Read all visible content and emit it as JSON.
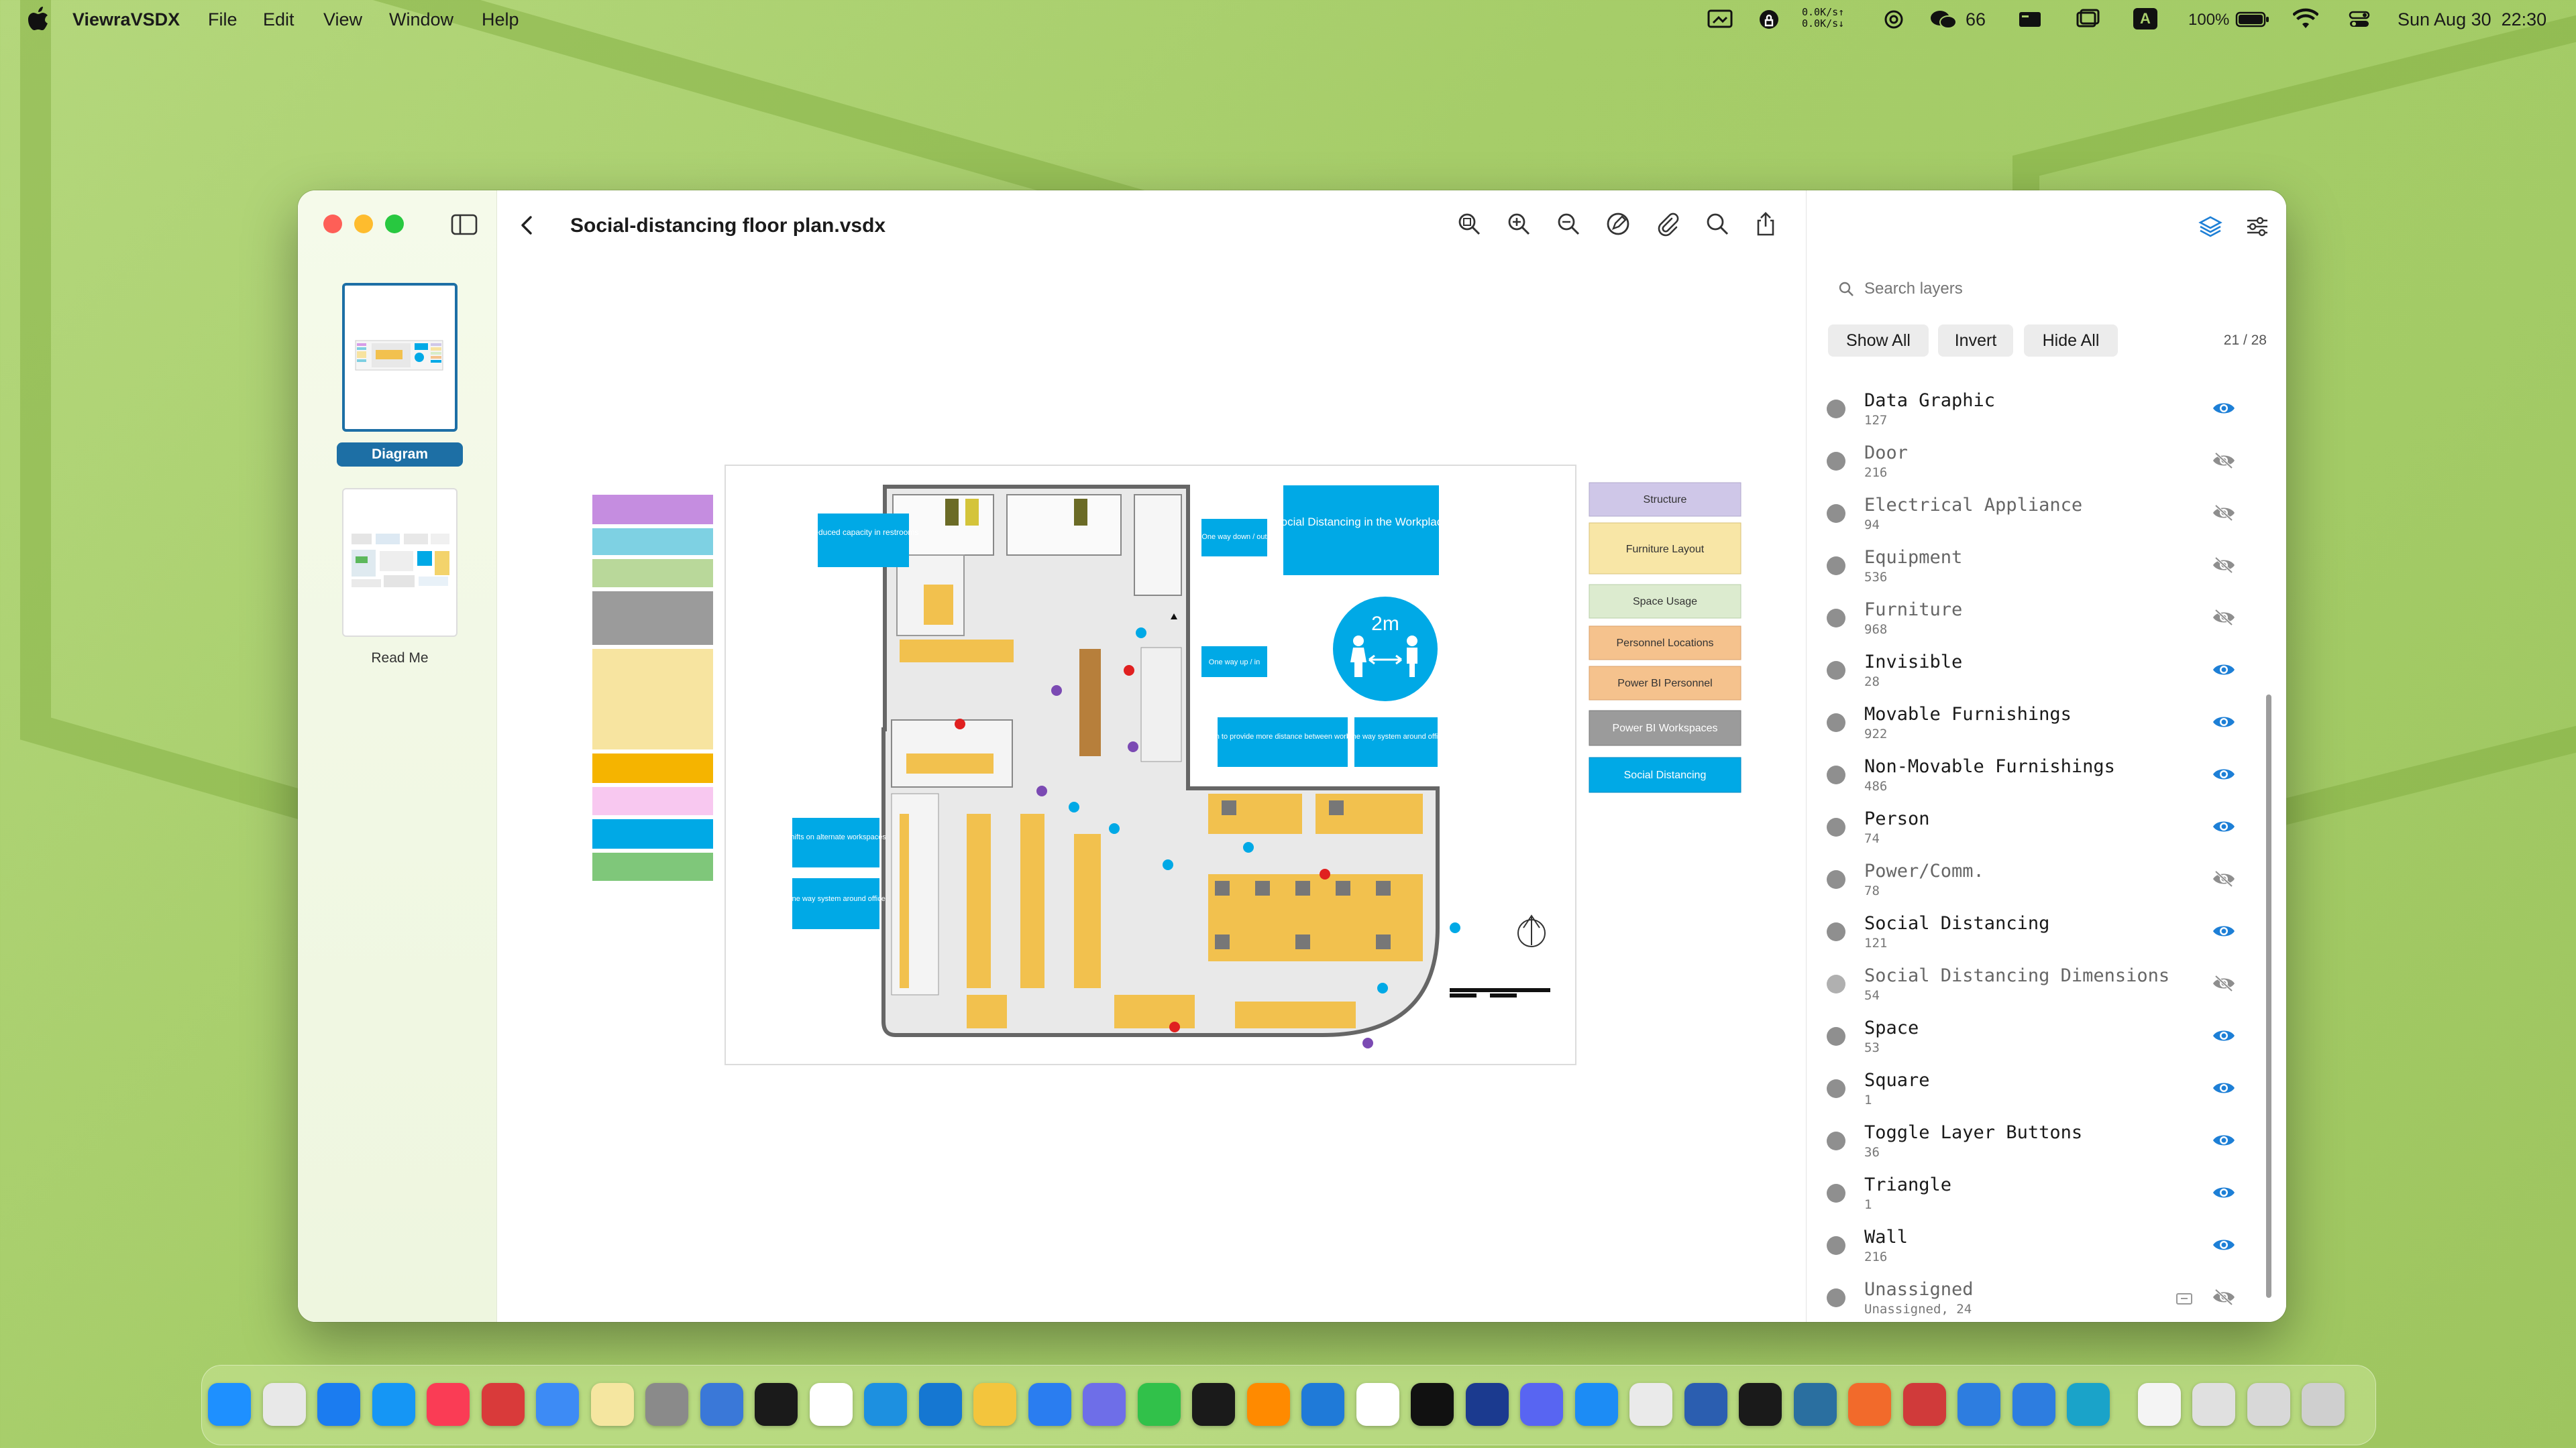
{
  "menubar": {
    "app_name": "ViewraVSDX",
    "menus": [
      "File",
      "Edit",
      "View",
      "Window",
      "Help"
    ],
    "net_up": "0.0K/s↑",
    "net_down": "0.0K/s↓",
    "wechat_count": "66",
    "input_method": "A",
    "battery": "100%",
    "datetime": "Sun Aug 30  22:30"
  },
  "window": {
    "title": "Social-distancing floor plan.vsdx",
    "pages": [
      {
        "label": "Diagram",
        "selected": true
      },
      {
        "label": "Read Me",
        "selected": false
      }
    ]
  },
  "diagram": {
    "legend_right": [
      "Structure",
      "Furniture Layout",
      "Space Usage",
      "Personnel Locations",
      "Power BI Personnel",
      "Power BI Workspaces",
      "Social Distancing"
    ],
    "signs": {
      "restroom": "Reduced capacity in restrooms",
      "one_way_down": "One way down / out",
      "one_way_up": "One way up / in",
      "workplace": "Social Distancing in the Workplace",
      "distance": "2m",
      "replan": "Re-plan to provide more distance between workstation",
      "one_way_system_mid": "One way system around office",
      "shifts": "Shifts on alternate workspaces",
      "one_way_system_left": "One way system around office"
    }
  },
  "layers_panel": {
    "search_placeholder": "Search layers",
    "show_all": "Show All",
    "invert": "Invert",
    "hide_all": "Hide All",
    "count": "21 / 28",
    "layers": [
      {
        "name": "Data Graphic",
        "count": "127",
        "visible": true
      },
      {
        "name": "Door",
        "count": "216",
        "visible": false
      },
      {
        "name": "Electrical Appliance",
        "count": "94",
        "visible": false
      },
      {
        "name": "Equipment",
        "count": "536",
        "visible": false
      },
      {
        "name": "Furniture",
        "count": "968",
        "visible": false
      },
      {
        "name": "Invisible",
        "count": "28",
        "visible": true
      },
      {
        "name": "Movable Furnishings",
        "count": "922",
        "visible": true
      },
      {
        "name": "Non-Movable Furnishings",
        "count": "486",
        "visible": true
      },
      {
        "name": "Person",
        "count": "74",
        "visible": true
      },
      {
        "name": "Power/Comm.",
        "count": "78",
        "visible": false
      },
      {
        "name": "Social Distancing",
        "count": "121",
        "visible": true
      },
      {
        "name": "Social Distancing Dimensions",
        "count": "54",
        "visible": false
      },
      {
        "name": "Space",
        "count": "53",
        "visible": true
      },
      {
        "name": "Square",
        "count": "1",
        "visible": true
      },
      {
        "name": "Toggle Layer Buttons",
        "count": "36",
        "visible": true
      },
      {
        "name": "Triangle",
        "count": "1",
        "visible": true
      },
      {
        "name": "Wall",
        "count": "216",
        "visible": true
      },
      {
        "name": "Unassigned",
        "count": "Unassigned, 24",
        "visible": false
      }
    ]
  },
  "colors": {
    "accent": "#1d7fd6",
    "sign_blue": "#00a9e6",
    "selected_page": "#1d6fa5"
  },
  "dock_apps": [
    "finder-icon",
    "launchpad-icon",
    "safari-icon",
    "app-store-icon",
    "music-icon",
    "dictionary-icon",
    "mail-icon",
    "notes-icon",
    "system-settings-icon",
    "preview-icon",
    "terminal-icon",
    "chrome-icon",
    "docker-icon",
    "pen-app-icon",
    "chatgpt-icon",
    "stocks-icon",
    "messenger-icon",
    "wechat-icon",
    "activity-monitor-icon",
    "sublime-icon",
    "vscode-icon",
    "notion-icon",
    "zed-icon",
    "affinity-icon",
    "discord-icon",
    "xcode-icon",
    "rocket-icon",
    "word-icon",
    "xmind-icon",
    "mongodb-icon",
    "brave-icon",
    "remote-desktop-icon",
    "windows-icon",
    "windows-app-icon",
    "viewra-icon",
    "document-icon",
    "downloads-icon",
    "screenshots-icon",
    "trash-icon"
  ]
}
